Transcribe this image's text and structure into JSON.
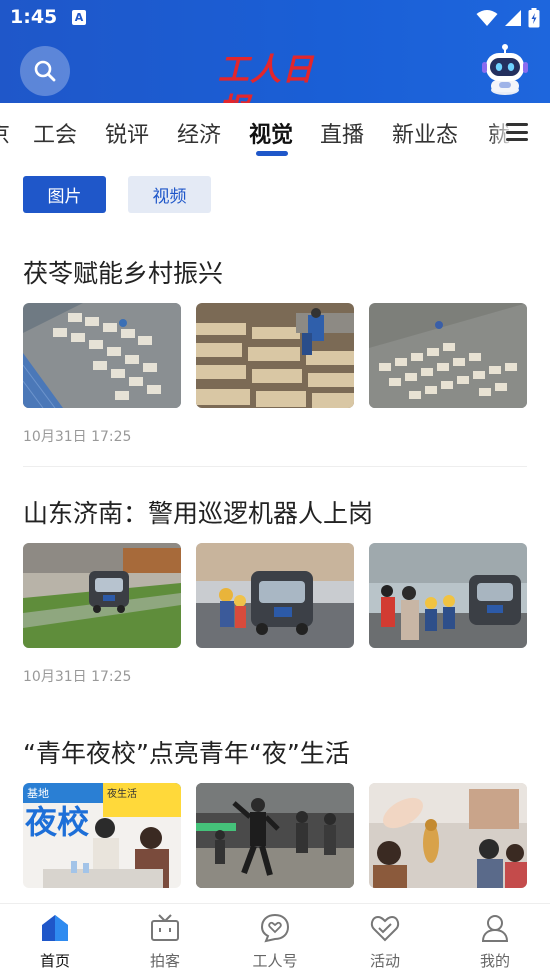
{
  "status_bar": {
    "time": "1:45",
    "notif_glyph": "A"
  },
  "header": {
    "logo_text": "工人日报",
    "brand_color": "#e3262c",
    "accent_color": "#1f57c9",
    "search_icon": "search-icon",
    "assistant_icon": "robot-assistant-icon"
  },
  "channels": [
    {
      "label": "京",
      "active": false
    },
    {
      "label": "工会",
      "active": false
    },
    {
      "label": "锐评",
      "active": false
    },
    {
      "label": "经济",
      "active": false
    },
    {
      "label": "视觉",
      "active": true
    },
    {
      "label": "直播",
      "active": false
    },
    {
      "label": "新业态",
      "active": false
    },
    {
      "label": "就",
      "active": false
    }
  ],
  "subtabs": [
    {
      "label": "图片",
      "selected": true
    },
    {
      "label": "视频",
      "selected": false
    }
  ],
  "articles": [
    {
      "title": "茯苓赋能乡村振兴",
      "time": "10月31日 17:25"
    },
    {
      "title": "山东济南：警用巡逻机器人上岗",
      "time": "10月31日 17:25"
    },
    {
      "title": "“青年夜校”点亮青年“夜”生活"
    }
  ],
  "thumb_overlay_texts": {
    "night_school": "夜校",
    "night_school_small": "夜生活",
    "top_left": "基地"
  },
  "bottom_nav": [
    {
      "label": "首页",
      "icon": "home-icon",
      "active": true
    },
    {
      "label": "拍客",
      "icon": "tv-icon",
      "active": false
    },
    {
      "label": "工人号",
      "icon": "chat-heart-icon",
      "active": false
    },
    {
      "label": "活动",
      "icon": "heart-icon",
      "active": false
    },
    {
      "label": "我的",
      "icon": "user-icon",
      "active": false
    }
  ]
}
